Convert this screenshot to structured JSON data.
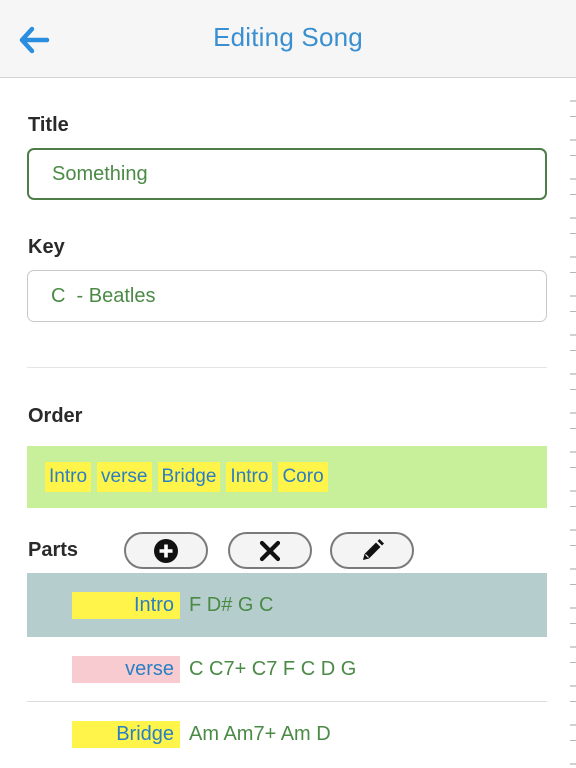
{
  "header": {
    "title": "Editing Song",
    "back_icon": "arrow-left-icon",
    "accent": "#3a8fd0"
  },
  "form": {
    "title_label": "Title",
    "title_value": "Something",
    "key_label": "Key",
    "key_value": "C  - Beatles"
  },
  "order": {
    "label": "Order",
    "items": [
      "Intro",
      "verse",
      "Bridge",
      "Intro",
      "Coro"
    ]
  },
  "parts": {
    "label": "Parts",
    "buttons": [
      {
        "name": "add",
        "icon": "plus-circle-icon"
      },
      {
        "name": "delete",
        "icon": "x-icon"
      },
      {
        "name": "edit",
        "icon": "pencil-icon"
      }
    ],
    "items": [
      {
        "name": "Intro",
        "chords": "F D# G C",
        "tag_color": "#fff44a",
        "selected": true
      },
      {
        "name": "verse",
        "chords": "C C7+ C7 F C D G",
        "tag_color": "#f7cbcf",
        "selected": false
      },
      {
        "name": "Bridge",
        "chords": "Am Am7+ Am D",
        "tag_color": "#fff44a",
        "selected": false
      }
    ]
  }
}
